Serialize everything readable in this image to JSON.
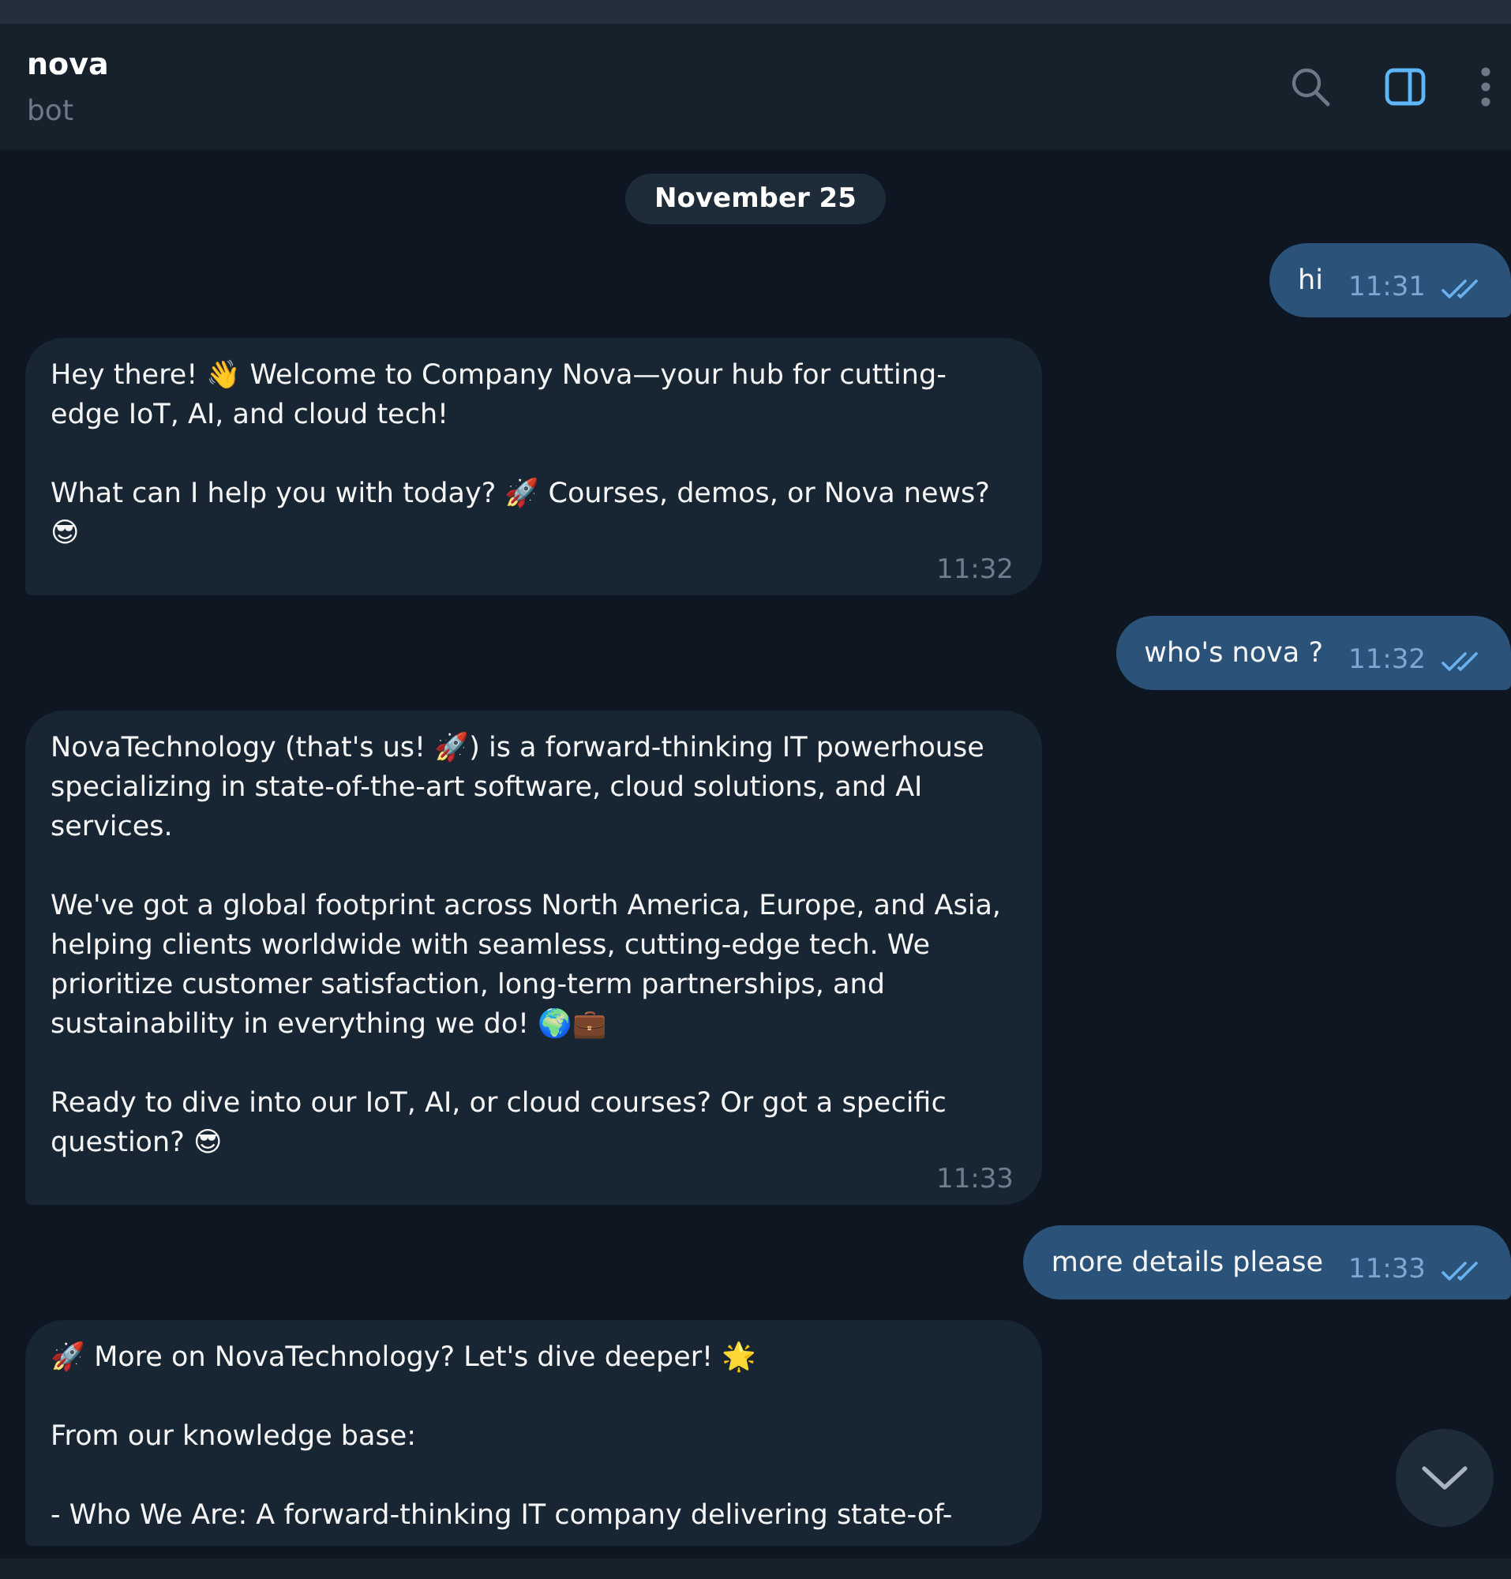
{
  "header": {
    "title": "nova",
    "subtitle": "bot"
  },
  "date_badge": "November 25",
  "messages": [
    {
      "kind": "outgoing",
      "text": "hi",
      "time": "11:31",
      "read": true
    },
    {
      "kind": "incoming",
      "text": "Hey there! 👋 Welcome to Company Nova—your hub for cutting-edge IoT, AI, and cloud tech!\n\nWhat can I help you with today? 🚀 Courses, demos, or Nova news? 😎",
      "time": "11:32"
    },
    {
      "kind": "outgoing",
      "text": "who's nova ?",
      "time": "11:32",
      "read": true
    },
    {
      "kind": "incoming",
      "text": "NovaTechnology (that's us! 🚀) is a forward-thinking IT powerhouse specializing in state-of-the-art software, cloud solutions, and AI services.\n\nWe've got a global footprint across North America, Europe, and Asia, helping clients worldwide with seamless, cutting-edge tech. We prioritize customer satisfaction, long-term partnerships, and sustainability in everything we do! 🌍💼\n\nReady to dive into our IoT, AI, or cloud courses? Or got a specific question? 😎",
      "time": "11:33"
    },
    {
      "kind": "outgoing",
      "text": "more details please",
      "time": "11:33",
      "read": true
    },
    {
      "kind": "incoming",
      "text": "🚀 More on NovaTechnology? Let's dive deeper! 🌟\n\nFrom our knowledge base:\n\n- Who We Are: A forward-thinking IT company delivering state-of-"
    }
  ]
}
